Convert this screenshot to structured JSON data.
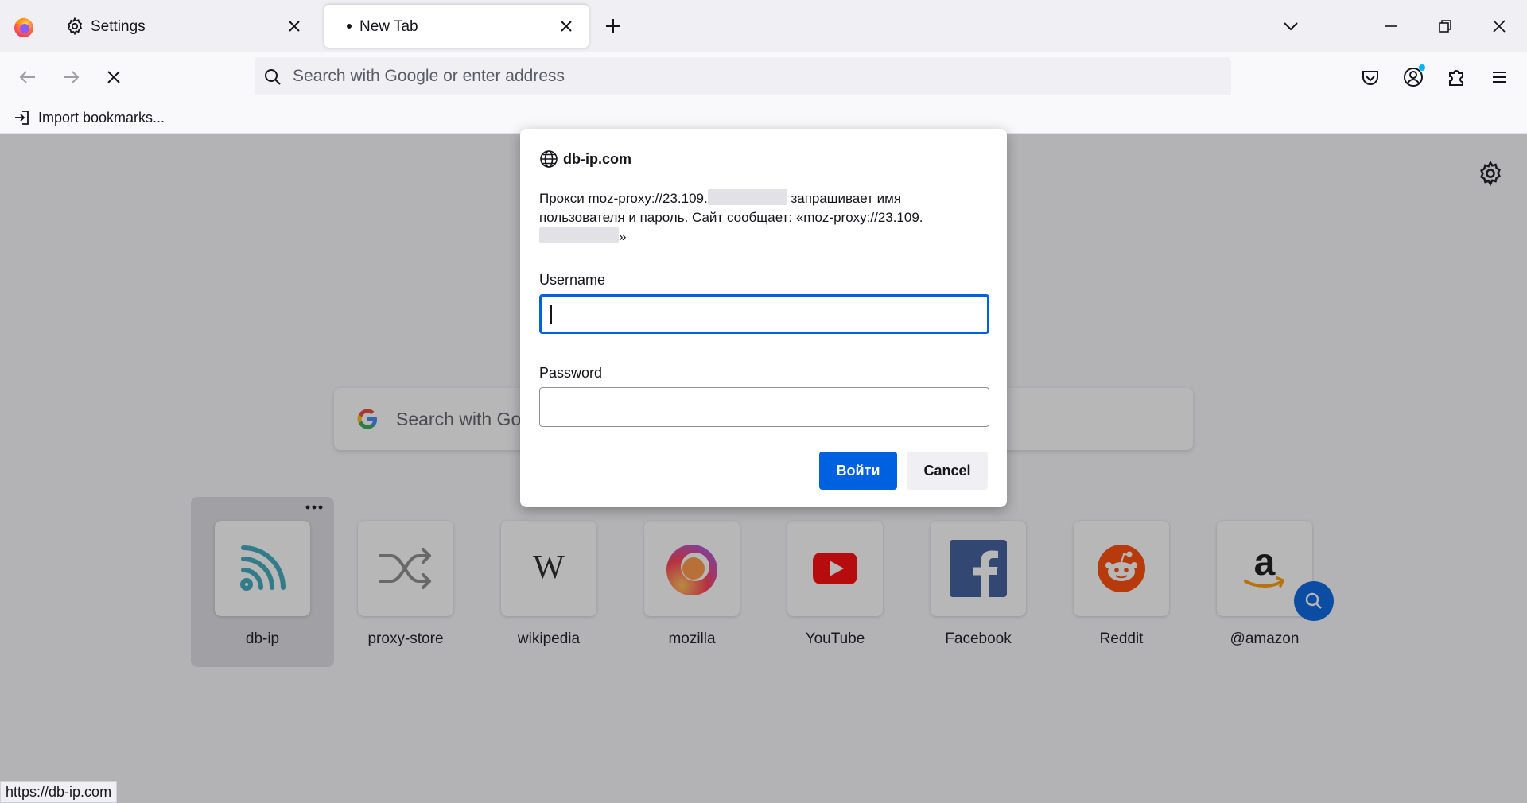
{
  "browser": {
    "tabs": [
      {
        "label": "Settings",
        "icon": "gear-icon"
      },
      {
        "label": "New Tab",
        "icon": "dot"
      }
    ],
    "urlbar": {
      "placeholder": "Search with Google or enter address"
    },
    "bookmarks": {
      "import_label": "Import bookmarks..."
    },
    "status_url": "https://db-ip.com"
  },
  "newtab": {
    "search_placeholder": "Search with Google or enter address",
    "tiles": [
      {
        "label": "db-ip",
        "icon": "wifi-icon"
      },
      {
        "label": "proxy-store",
        "icon": "shuffle-icon"
      },
      {
        "label": "wikipedia",
        "icon": "wikipedia-icon"
      },
      {
        "label": "mozilla",
        "icon": "firefox-icon"
      },
      {
        "label": "YouTube",
        "icon": "youtube-icon"
      },
      {
        "label": "Facebook",
        "icon": "facebook-icon"
      },
      {
        "label": "Reddit",
        "icon": "reddit-icon"
      },
      {
        "label": "@amazon",
        "icon": "amazon-icon"
      }
    ]
  },
  "dialog": {
    "origin": "db-ip.com",
    "message_part1": "Прокси moz-proxy://23.109.",
    "message_part2": " запрашивает имя пользователя и пароль. Сайт сообщает: «moz-proxy://23.109.",
    "message_part3": "»",
    "username_label": "Username",
    "username_value": "",
    "password_label": "Password",
    "password_value": "",
    "login_label": "Войти",
    "cancel_label": "Cancel"
  },
  "colors": {
    "accent": "#0061e0",
    "tab_strip": "#f0f0f4",
    "urlbar_bg": "#f0f0f4"
  }
}
